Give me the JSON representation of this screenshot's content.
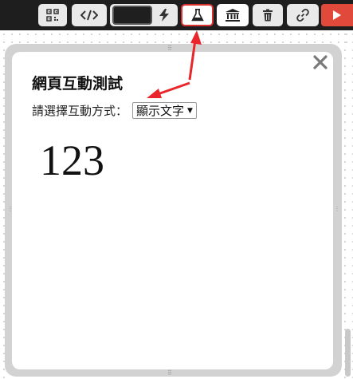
{
  "toolbar": {
    "buttons": [
      {
        "name": "qr-code-button",
        "icon": "qr-code-icon"
      },
      {
        "name": "code-button",
        "icon": "code-brackets-icon"
      },
      {
        "name": "speed-button",
        "icon": "lightning-icon"
      },
      {
        "name": "lab-button",
        "icon": "flask-icon",
        "highlighted": true
      },
      {
        "name": "library-button",
        "icon": "bank-icon"
      },
      {
        "name": "delete-button",
        "icon": "trash-icon"
      },
      {
        "name": "link-button",
        "icon": "link-icon"
      },
      {
        "name": "run-button",
        "icon": "play-icon"
      }
    ],
    "highlight_color": "#d93030",
    "run_color": "#e14a3a"
  },
  "dialog": {
    "title": "網頁互動測試",
    "mode_label": "請選擇互動方式：",
    "mode_selected": "顯示文字",
    "output_value": "123",
    "close_icon": "close-icon"
  },
  "annotations": {
    "arrow_color": "#e8262b",
    "arrows": [
      "points-to-lab-button",
      "points-to-mode-select"
    ]
  }
}
